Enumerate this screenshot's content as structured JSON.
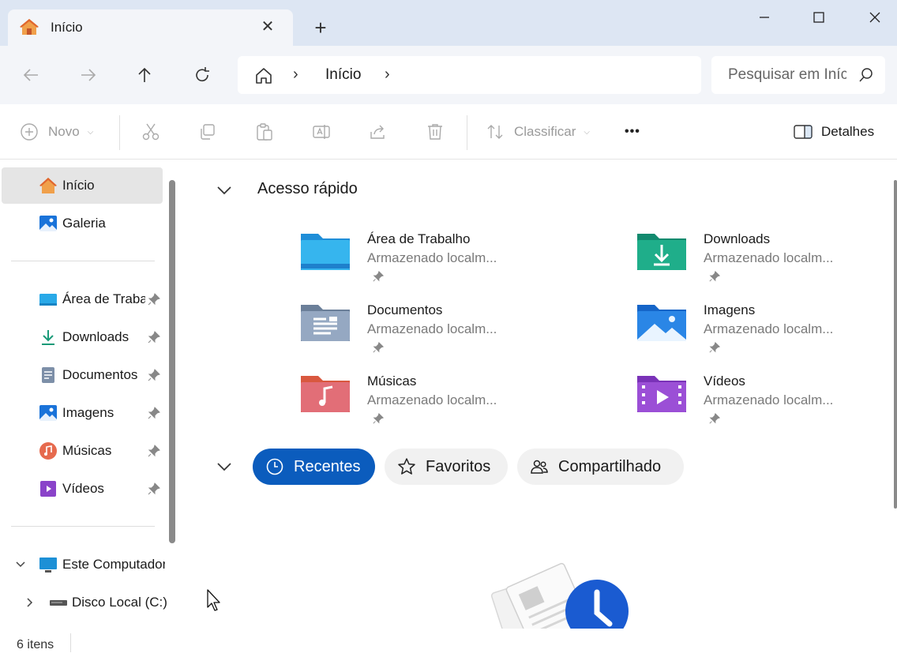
{
  "tab": {
    "title": "Início",
    "close": "✕",
    "new": "+"
  },
  "nav": {
    "address_crumb": "Início",
    "address_sep": "›",
    "search_placeholder": "Pesquisar em Início"
  },
  "toolbar": {
    "new_label": "Novo",
    "sort_label": "Classificar",
    "more_label": "•••",
    "details_label": "Detalhes"
  },
  "sidebar": {
    "top_items": [
      {
        "label": "Início",
        "icon": "home-icon",
        "selected": true
      },
      {
        "label": "Galeria",
        "icon": "gallery-icon"
      }
    ],
    "pinned_items": [
      {
        "label": "Área de Trabalho",
        "icon": "desktop-folder-icon"
      },
      {
        "label": "Downloads",
        "icon": "download-icon"
      },
      {
        "label": "Documentos",
        "icon": "document-icon"
      },
      {
        "label": "Imagens",
        "icon": "pictures-icon"
      },
      {
        "label": "Músicas",
        "icon": "music-icon"
      },
      {
        "label": "Vídeos",
        "icon": "video-icon"
      }
    ],
    "tree_items": [
      {
        "label": "Este Computador",
        "icon": "computer-icon"
      },
      {
        "label": "Disco Local (C:)",
        "icon": "drive-icon"
      }
    ]
  },
  "main": {
    "quick_access_title": "Acesso rápido",
    "quick_access": [
      {
        "name": "Área de Trabalho",
        "sub": "Armazenado localm...",
        "icon": "desktop-folder-icon"
      },
      {
        "name": "Downloads",
        "sub": "Armazenado localm...",
        "icon": "downloads-folder-icon"
      },
      {
        "name": "Documentos",
        "sub": "Armazenado localm...",
        "icon": "documents-folder-icon"
      },
      {
        "name": "Imagens",
        "sub": "Armazenado localm...",
        "icon": "pictures-folder-icon"
      },
      {
        "name": "Músicas",
        "sub": "Armazenado localm...",
        "icon": "music-folder-icon"
      },
      {
        "name": "Vídeos",
        "sub": "Armazenado localm...",
        "icon": "videos-folder-icon"
      }
    ],
    "pills": [
      {
        "label": "Recentes",
        "active": true,
        "icon": "clock-icon"
      },
      {
        "label": "Favoritos",
        "active": false,
        "icon": "star-icon"
      },
      {
        "label": "Compartilhado",
        "active": false,
        "icon": "people-icon"
      }
    ]
  },
  "status": {
    "items_count": "6 itens"
  },
  "colors": {
    "accent": "#0b5cbd",
    "titlebar": "#dde6f3",
    "navbar": "#f3f5f9"
  }
}
